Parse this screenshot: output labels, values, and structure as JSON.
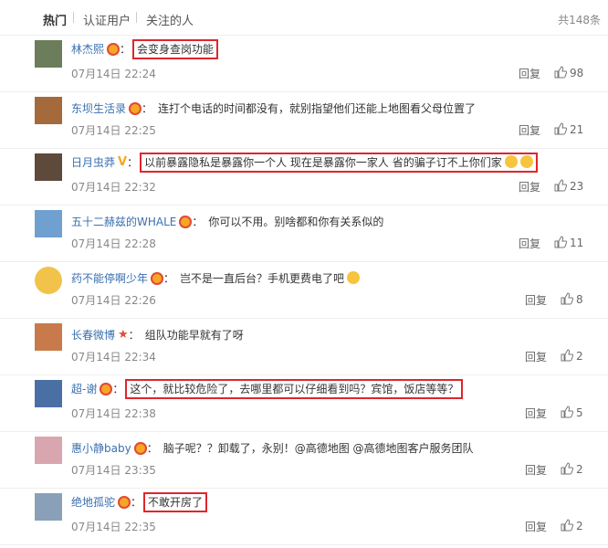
{
  "tabs": [
    {
      "label": "热门"
    },
    {
      "label": "认证用户"
    },
    {
      "label": "关注的人"
    }
  ],
  "total": "共148条",
  "comments": [
    {
      "name": "林杰熙",
      "badge": "crown",
      "text": "会变身查岗功能",
      "time": "07月14日 22:24",
      "reply": "回复",
      "likes": "98",
      "boxed": true
    },
    {
      "name": "东坝生活录",
      "badge": "crown",
      "text": "连打个电话的时间都没有，就别指望他们还能上地图看父母位置了",
      "time": "07月14日 22:25",
      "reply": "回复",
      "likes": "21",
      "boxed": false
    },
    {
      "name": "日月虫莽",
      "badge": "v",
      "text": "以前暴露隐私是暴露你一个人 现在是暴露你一家人 省的骗子订不上你们家",
      "time": "07月14日 22:32",
      "reply": "回复",
      "likes": "23",
      "boxed": true
    },
    {
      "name": "五十二赫兹的WHALE",
      "badge": "crown",
      "text": "你可以不用。别啥都和你有关系似的",
      "time": "07月14日 22:28",
      "reply": "回复",
      "likes": "11",
      "boxed": false
    },
    {
      "name": "药不能停啊少年",
      "badge": "crown",
      "text": "岂不是一直后台？手机更费电了吧",
      "time": "07月14日 22:26",
      "reply": "回复",
      "likes": "8",
      "boxed": false
    },
    {
      "name": "长春微博",
      "badge": "star",
      "text": "组队功能早就有了呀",
      "time": "07月14日 22:34",
      "reply": "回复",
      "likes": "2",
      "boxed": false
    },
    {
      "name": "超-谢",
      "badge": "crown",
      "text": "这个，就比较危险了，去哪里都可以仔细看到吗？宾馆，饭店等等？",
      "time": "07月14日 22:38",
      "reply": "回复",
      "likes": "5",
      "boxed": true
    },
    {
      "name": "惠小静baby",
      "badge": "crown",
      "text": "脑子呢？？卸载了，永别！@高德地图 @高德地图客户服务团队",
      "time": "07月14日 23:35",
      "reply": "回复",
      "likes": "2",
      "boxed": false
    },
    {
      "name": "绝地孤驼",
      "badge": "crown",
      "text": "不敢开房了",
      "time": "07月14日 22:35",
      "reply": "回复",
      "likes": "2",
      "boxed": true
    }
  ],
  "colors": {
    "link": "#3a6fb0",
    "highlight": "#e0252c",
    "crown": "#f5a623"
  }
}
